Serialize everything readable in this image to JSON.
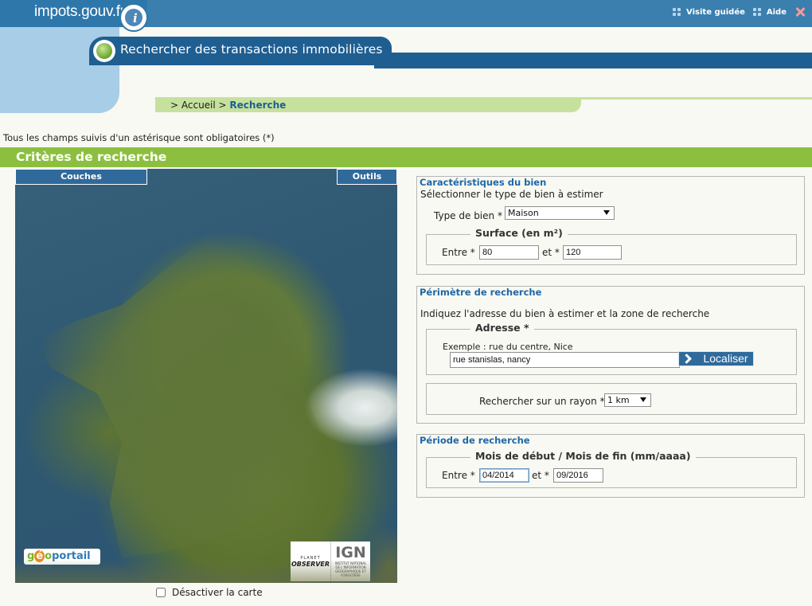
{
  "header": {
    "site_name": "impots.gouv.fr",
    "info_glyph": "i",
    "links": [
      {
        "label": "Visite guidée"
      },
      {
        "label": "Aide"
      }
    ],
    "page_title": "Rechercher des transactions immobilières"
  },
  "breadcrumb": {
    "home": "> Accueil",
    "separator": " > ",
    "current": "Recherche"
  },
  "form": {
    "required_note": "Tous les champs suivis d'un astérisque sont obligatoires (*)",
    "criteria_title": "Critères de recherche",
    "map": {
      "layers_tab": "Couches",
      "tools_tab": "Outils",
      "geo_g": "g",
      "geo_o": "é",
      "geo_rest": "o",
      "geo_portail": "portail",
      "planet_top": "PLANET",
      "planet_bottom": "OBSERVER",
      "ign_mark": "IGN",
      "ign_sub": "INSTITUT NATIONAL DE L'INFORMATION GÉOGRAPHIQUE ET FORESTIÈRE",
      "disable_label": "Désactiver la carte"
    },
    "property": {
      "title": "Caractéristiques du bien",
      "instruction": "Sélectionner le type de bien à estimer",
      "type_label": "Type de bien",
      "asterisk": "*",
      "type_value": "Maison",
      "surface_legend": "Surface (en m²)",
      "between_label": "Entre",
      "and_label": "et",
      "surface_min": "80",
      "surface_max": "120"
    },
    "perimeter": {
      "title": "Périmètre de recherche",
      "instruction": "Indiquez l'adresse du bien à estimer et la zone de recherche",
      "address_legend": "Adresse *",
      "example": "Exemple : rue du centre, Nice",
      "address_value": "rue stanislas, nancy",
      "locate_label": "Localiser",
      "radius_label": "Rechercher sur un rayon",
      "radius_value": "1 km"
    },
    "period": {
      "title": "Période de recherche",
      "legend": "Mois de début / Mois de fin (mm/aaaa)",
      "between_label": "Entre",
      "and_label": "et",
      "start_value": "04/2014",
      "end_value": "09/2016"
    }
  },
  "colors": {
    "header_blue": "#3a7fae",
    "dark_blue": "#1f5e91",
    "light_blue": "#a8cde6",
    "green_bar": "#8cbf3f",
    "breadcrumb_green": "#c6e19e",
    "page_bg": "#f8f9f2"
  }
}
